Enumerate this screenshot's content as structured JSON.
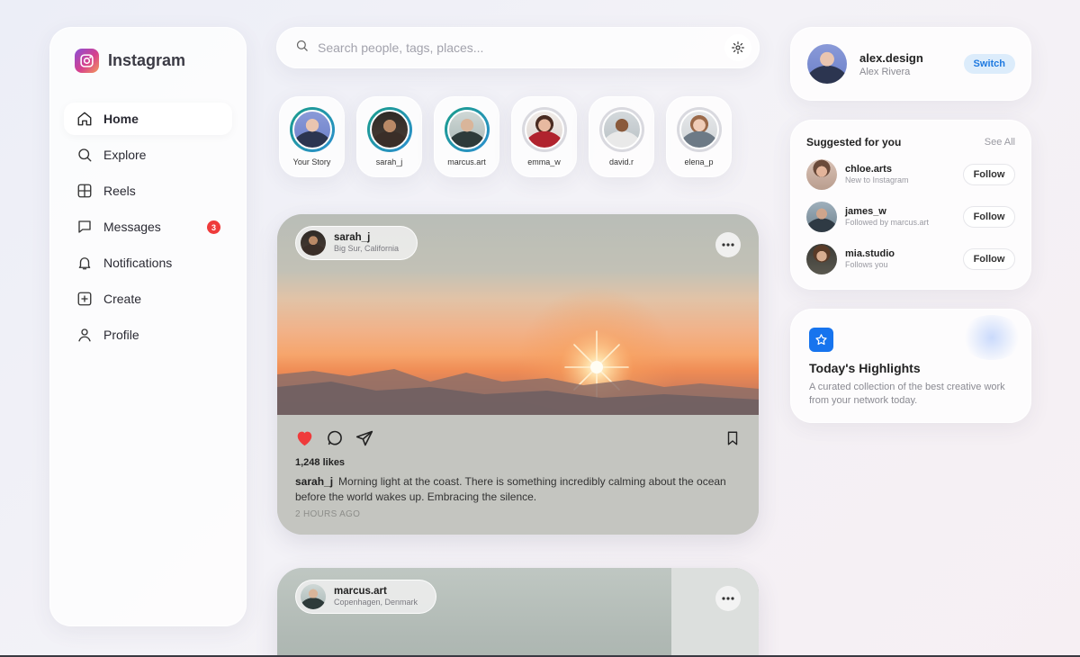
{
  "app": {
    "name": "Instagram"
  },
  "nav": {
    "items": [
      {
        "label": "Home",
        "icon": "home-icon",
        "active": true
      },
      {
        "label": "Explore",
        "icon": "search-icon"
      },
      {
        "label": "Reels",
        "icon": "reels-icon"
      },
      {
        "label": "Messages",
        "icon": "message-icon",
        "badge": "3"
      },
      {
        "label": "Notifications",
        "icon": "bell-icon"
      },
      {
        "label": "Create",
        "icon": "plus-square-icon"
      },
      {
        "label": "Profile",
        "icon": "user-icon"
      }
    ]
  },
  "search": {
    "placeholder": "Search people, tags, places..."
  },
  "stories": [
    {
      "label": "Your Story",
      "ring": "active"
    },
    {
      "label": "sarah_j",
      "ring": "active"
    },
    {
      "label": "marcus.art",
      "ring": "active"
    },
    {
      "label": "emma_w",
      "ring": "seen"
    },
    {
      "label": "david.r",
      "ring": "seen"
    },
    {
      "label": "elena_p",
      "ring": "seen"
    }
  ],
  "posts": [
    {
      "user": "sarah_j",
      "location": "Big Sur, California",
      "likes": "1,248 likes",
      "caption_user": "sarah_j",
      "caption": "Morning light at the coast. There is something incredibly calming about the ocean before the world wakes up. Embracing the silence.",
      "time": "2 HOURS AGO",
      "liked": true
    },
    {
      "user": "marcus.art",
      "location": "Copenhagen, Denmark"
    }
  ],
  "profile": {
    "handle": "alex.design",
    "name": "Alex Rivera",
    "switch_label": "Switch"
  },
  "suggestions": {
    "title": "Suggested for you",
    "see_all": "See All",
    "follow_label": "Follow",
    "items": [
      {
        "user": "chloe.arts",
        "sub": "New to Instagram"
      },
      {
        "user": "james_w",
        "sub": "Followed by marcus.art"
      },
      {
        "user": "mia.studio",
        "sub": "Follows you"
      }
    ]
  },
  "highlights": {
    "title": "Today's Highlights",
    "description": "A curated collection of the best creative work from your network today."
  },
  "colors": {
    "accent": "#1774ee",
    "like": "#ef3b3b",
    "switch_bg": "#dcecfb",
    "story_ring": "#1a9d8a"
  }
}
